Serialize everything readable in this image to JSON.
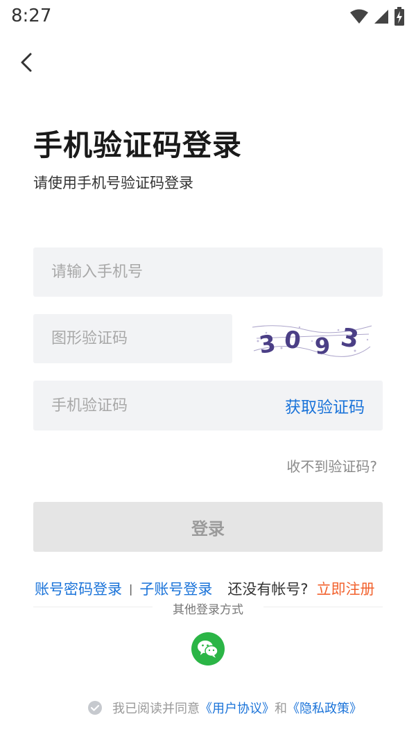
{
  "status_bar": {
    "time": "8:27"
  },
  "header": {
    "title": "手机验证码登录",
    "subtitle": "请使用手机号验证码登录"
  },
  "form": {
    "phone_placeholder": "请输入手机号",
    "captcha_placeholder": "图形验证码",
    "captcha_text": "3093",
    "code_placeholder": "手机验证码",
    "get_code_label": "获取验证码",
    "no_code_label": "收不到验证码?",
    "login_label": "登录"
  },
  "alt_login": {
    "password_login": "账号密码登录",
    "separator": "|",
    "sub_account_login": "子账号登录",
    "no_account": "还没有帐号?",
    "register": "立即注册"
  },
  "other_methods": {
    "label": "其他登录方式"
  },
  "agreement": {
    "prefix": "我已阅读并同意",
    "user_agreement": "《用户协议》",
    "and": "和",
    "privacy_policy": "《隐私政策》"
  },
  "colors": {
    "link_blue": "#1a73d9",
    "register_orange": "#f2622e",
    "wechat_green": "#2bb546",
    "field_bg": "#f2f3f5",
    "button_disabled": "#e5e5e5"
  },
  "icons": [
    "back-chevron-icon",
    "wifi-icon",
    "signal-icon",
    "battery-icon",
    "wechat-icon",
    "check-circle-icon"
  ]
}
